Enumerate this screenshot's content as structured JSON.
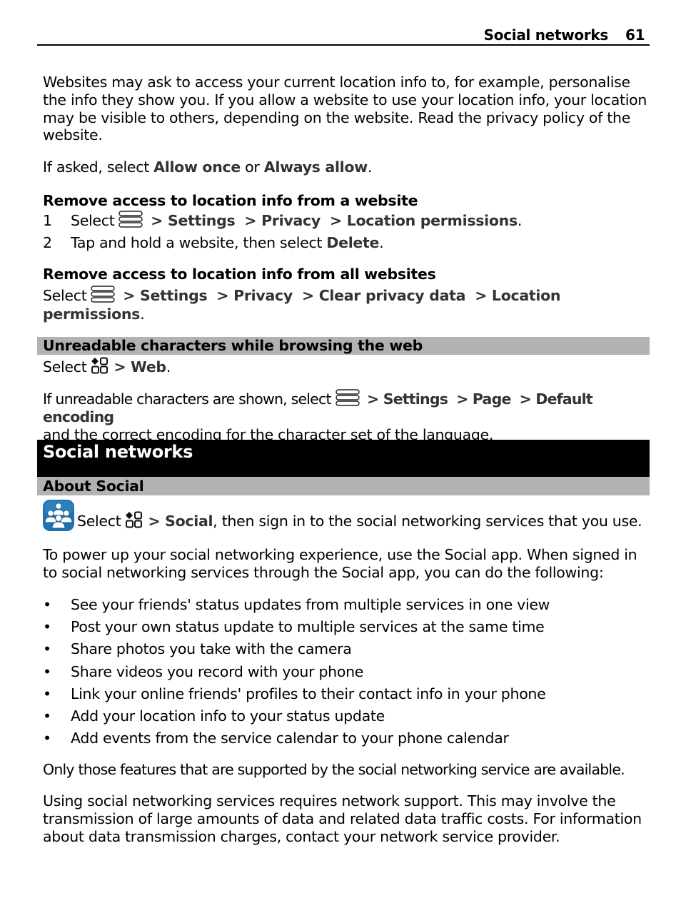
{
  "header": {
    "section_title": "Social networks",
    "page_number": "61"
  },
  "intro": {
    "paragraph": "Websites may ask to access your current location info to, for example, personalise the info they show you. If you allow a website to use your location info, your location may be visible to others, depending on the website. Read the privacy policy of the website.",
    "if_asked_prefix": "If asked, select ",
    "allow_once": "Allow once",
    "or": " or ",
    "always_allow": "Always allow",
    "period": "."
  },
  "remove_one": {
    "heading": "Remove access to location info from a website",
    "steps": [
      {
        "number": "1",
        "prefix": "Select",
        "icon": "menu-icon",
        "path": [
          " > Settings",
          " > Privacy",
          " > Location permissions"
        ],
        "suffix": "."
      },
      {
        "number": "2",
        "text": "Tap and hold a website, then select ",
        "bold": "Delete",
        "suffix": "."
      }
    ]
  },
  "remove_all": {
    "heading": "Remove access to location info from all websites",
    "prefix": "Select",
    "icon": "menu-icon",
    "path": [
      " > Settings",
      " > Privacy",
      " > Clear privacy data",
      " > Location permissions"
    ],
    "suffix": "."
  },
  "unreadable": {
    "heading": "Unreadable characters while browsing the web",
    "select_prefix": "Select",
    "select_icon": "apps-icon",
    "select_target": "> Web",
    "select_suffix": ".",
    "line_prefix": "If unreadable characters are shown, select",
    "line_icon": "menu-icon",
    "path": [
      " > Settings",
      " > Page",
      " > Default encoding"
    ],
    "line_continuation": "and the correct encoding for the character set of the language."
  },
  "social": {
    "chapter_title": "Social networks",
    "section_heading": "About Social",
    "app_icon": "social-app-icon",
    "select_prefix": "Select",
    "select_icon": "apps-icon",
    "select_target": "> Social",
    "select_suffix": ", then sign in to the social networking services that you use.",
    "paragraph1": "To power up your social networking experience, use the Social app. When signed in to social networking services through the Social app, you can do the following:",
    "bullet_glyph": "•",
    "bullets": [
      "See your friends' status updates from multiple services in one view",
      "Post your own status update to multiple services at the same time",
      "Share photos you take with the camera",
      "Share videos you record with your phone",
      "Link your online friends' profiles to their contact info in your phone",
      "Add your location info to your status update",
      "Add events from the service calendar to your phone calendar"
    ],
    "paragraph2": "Only those features that are supported by the social networking service are available.",
    "paragraph3": "Using social networking services requires network support. This may involve the transmission of large amounts of data and related data traffic costs. For information about data transmission charges, contact your network service provider."
  },
  "colors": {
    "bold_text": "#333333",
    "section_bar": "#b2b2b2",
    "chapter_bar": "#000000",
    "social_icon_blue": "#1e72b0"
  }
}
